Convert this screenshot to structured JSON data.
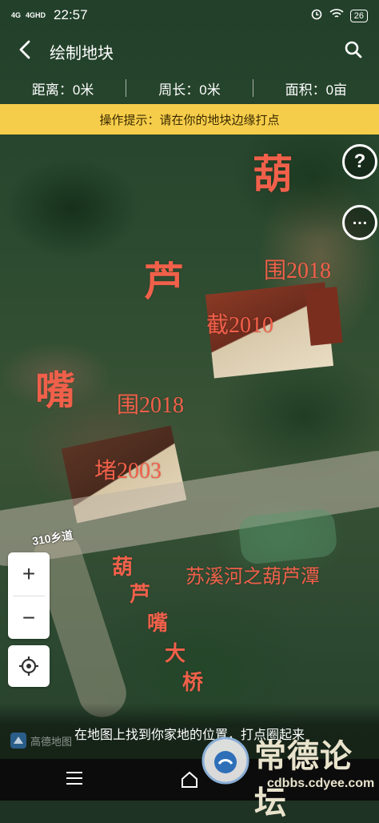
{
  "status_bar": {
    "network1": "4G",
    "network2": "4GHD",
    "time": "22:57",
    "battery": "26"
  },
  "header": {
    "title": "绘制地块"
  },
  "stats": {
    "distance_label": "距离：",
    "distance_value": "0米",
    "perimeter_label": "周长：",
    "perimeter_value": "0米",
    "area_label": "面积：",
    "area_value": "0亩"
  },
  "tip": {
    "text": "操作提示：请在你的地块边缘打点"
  },
  "map": {
    "road_label": "310乡道",
    "annotations": {
      "name_char1": "葫",
      "name_char2": "芦",
      "name_char3": "嘴",
      "wei2018_top": "围2018",
      "jie2010": "截2010",
      "wei2018_mid": "围2018",
      "du2003": "堵2003",
      "bridge_1": "葫",
      "bridge_2": "芦",
      "bridge_3": "嘴",
      "bridge_4": "大",
      "bridge_5": "桥",
      "pool": "苏溪河之葫芦潭"
    },
    "accent_color": "#f0604a"
  },
  "controls": {
    "help": "?",
    "more": "…",
    "zoom_in": "+",
    "zoom_out": "−"
  },
  "bottom": {
    "hint": "在地图上找到你家地的位置，打点圈起来",
    "map_provider": "高德地图"
  },
  "watermark": {
    "brand": "常德论坛",
    "url": "cdbbs.cdyee.com"
  },
  "colors": {
    "tip_bg": "#f6cd4a",
    "tip_text": "#3a2a00"
  }
}
